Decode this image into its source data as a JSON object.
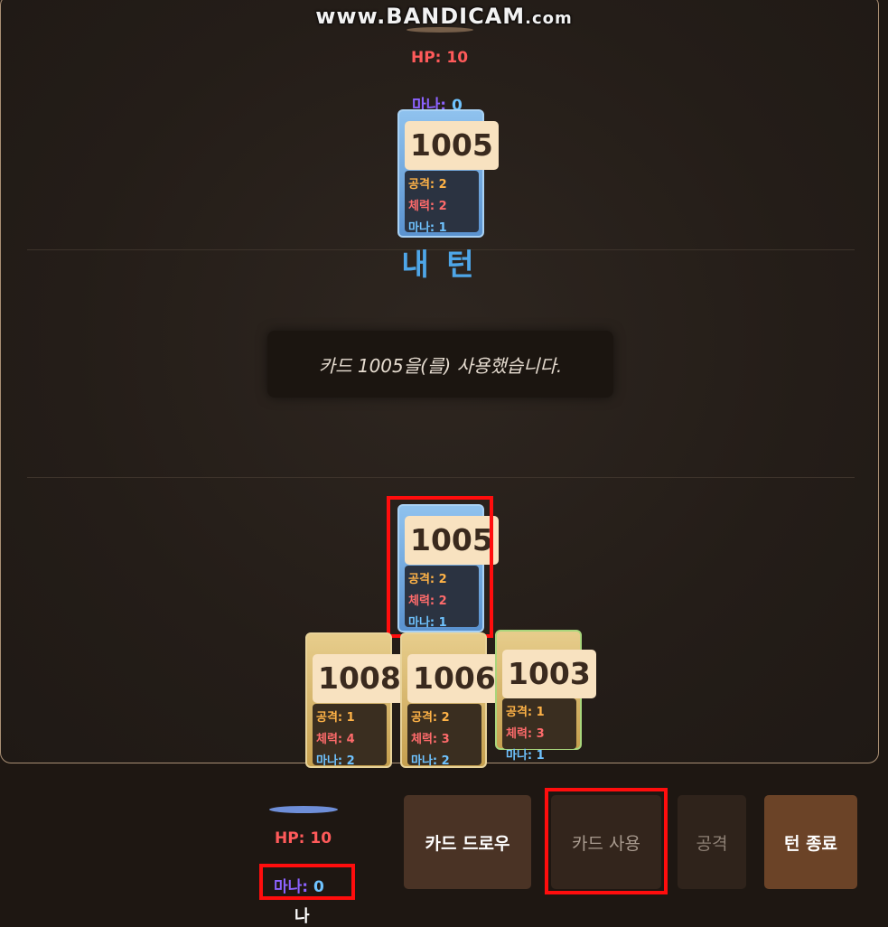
{
  "watermark": {
    "main": "www.BANDICAM",
    "suffix": ".com"
  },
  "opponent": {
    "hp_label": "HP: 10",
    "mana_key": "마나:",
    "mana_value": "0",
    "played_card": {
      "id": "1005",
      "attack": "공격: 2",
      "health": "체력: 2",
      "mana": "마나: 1"
    }
  },
  "turn_indicator": "내 턴",
  "log_message": "카드 1005을(를) 사용했습니다.",
  "player": {
    "played_card": {
      "id": "1005",
      "attack": "공격: 2",
      "health": "체력: 2",
      "mana": "마나: 1"
    },
    "hand": [
      {
        "id": "1008",
        "attack": "공격: 1",
        "health": "체력: 4",
        "mana": "마나: 2"
      },
      {
        "id": "1006",
        "attack": "공격: 2",
        "health": "체력: 3",
        "mana": "마나: 2"
      },
      {
        "id": "1003",
        "attack": "공격: 1",
        "health": "체력: 3",
        "mana": "마나: 1"
      }
    ],
    "hp_label": "HP: 10",
    "mana_key": "마나:",
    "mana_value": "0",
    "name": "나"
  },
  "actions": {
    "draw": "카드 드로우",
    "use": "카드 사용",
    "attack": "공격",
    "end_turn": "턴 종료"
  },
  "colors": {
    "highlight": "#ff0d0d",
    "turn": "#4ea6e8",
    "hp": "#ff5a5a"
  }
}
